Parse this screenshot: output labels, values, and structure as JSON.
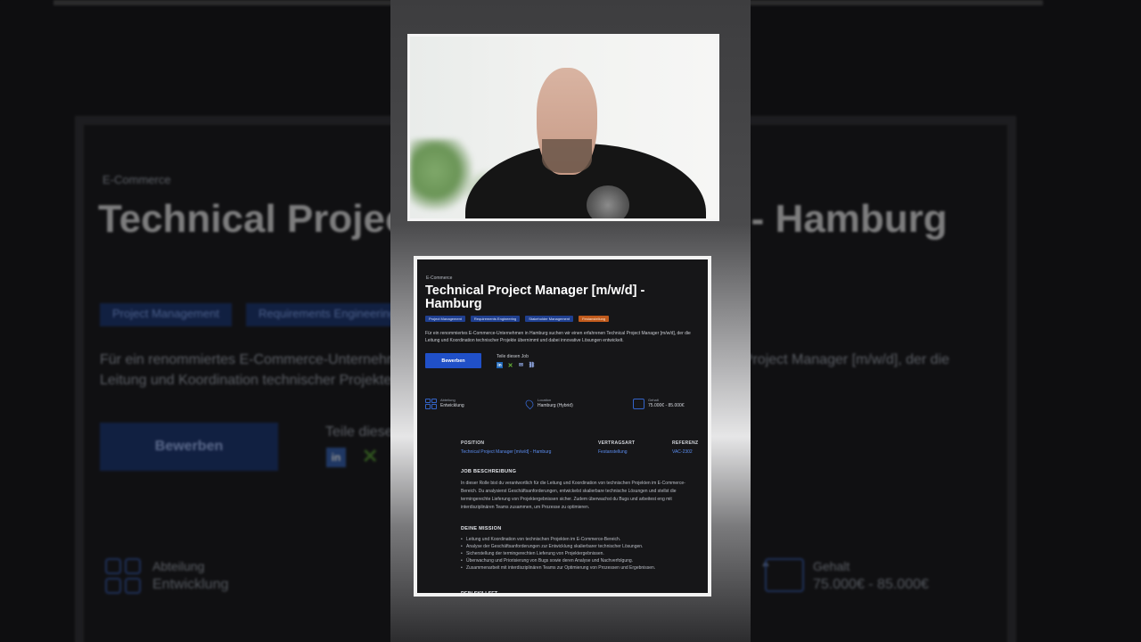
{
  "job": {
    "category": "E-Commerce",
    "title": "Technical Project Manager [m/w/d] - Hamburg",
    "tags": [
      {
        "label": "Project Management"
      },
      {
        "label": "Requirements Engineering"
      },
      {
        "label": "Stakeholder Management"
      },
      {
        "label": "Festanstellung"
      }
    ],
    "intro": "Für ein renommiertes E-Commerce-Unternehmen in Hamburg suchen wir einen erfahrenen Technical Project Manager [m/w/d], der die Leitung und Koordination technischer Projekte übernimmt und dabei innovative Lösungen entwickelt.",
    "apply_label": "Bewerben",
    "share_label": "Teile diesen Job",
    "share_icons": [
      "linkedin-icon",
      "xing-icon",
      "mail-icon",
      "link-icon"
    ],
    "stats": [
      {
        "label": "Abteilung",
        "value": "Entwicklung",
        "icon": "grid-icon"
      },
      {
        "label": "Location",
        "value": "Hamburg (Hybrid)",
        "icon": "location-pin-icon"
      },
      {
        "label": "Gehalt",
        "value": "75.000€ - 85.000€",
        "icon": "money-icon"
      }
    ],
    "meta": {
      "position_label": "POSITION",
      "position_value": "Technical Project Manager [m/w/d] - Hamburg",
      "contract_label": "VERTRAGSART",
      "contract_value": "Festanstellung",
      "reference_label": "REFERENZ",
      "reference_value": "VAC-2302"
    },
    "description_heading": "JOB BESCHREIBUNG",
    "description": "In dieser Rolle bist du verantwortlich für die Leitung und Koordination von technischen Projekten im E-Commerce-Bereich. Du analysierst Geschäftsanforderungen, entwickelst skalierbare technische Lösungen und stellst die termingerechte Lieferung von Projektergebnissen sicher. Zudem überwachst du Bugs und arbeitest eng mit interdisziplinären Teams zusammen, um Prozesse zu optimieren.",
    "mission_heading": "DEINE MISSION",
    "mission": [
      "Leitung und Koordination von technischen Projekten im E-Commerce-Bereich.",
      "Analyse der Geschäftsanforderungen zur Entwicklung skalierbarer technischer Lösungen.",
      "Sicherstellung der termingerechten Lieferung von Projektergebnissen.",
      "Überwachung und Priorisierung von Bugs sowie deren Analyse und Nachverfolgung.",
      "Zusammenarbeit mit interdisziplinären Teams zur Optimierung von Prozessen und Ergebnissen."
    ],
    "next_heading": "DEIN SKILLSET"
  },
  "background": {
    "kicker": "E-Commerce",
    "title": "Technical Project Manager [m/w/d] - Hamburg",
    "tag1": "Project Management",
    "tag2": "Requirements Engineering",
    "intro": "Für ein renommiertes E-Commerce-Unternehmen in Hamburg suchen wir einen erfahrenen Technical Project Manager [m/w/d], der die Leitung und Koordination technischer Projekte übernimmt und dabei innovative Lösungen entwickelt.",
    "apply": "Bewerben",
    "share": "Teile diesen Job",
    "stat1_label": "Abteilung",
    "stat1_value": "Entwicklung",
    "stat3_label": "Gehalt",
    "stat3_value": "75.000€ - 85.000€"
  },
  "colors": {
    "accent": "#2050c8",
    "tag_blue": "#1f3f8f",
    "tag_orange": "#c05a1c",
    "link_blue": "#5b8df0",
    "card_bg": "#161618"
  }
}
